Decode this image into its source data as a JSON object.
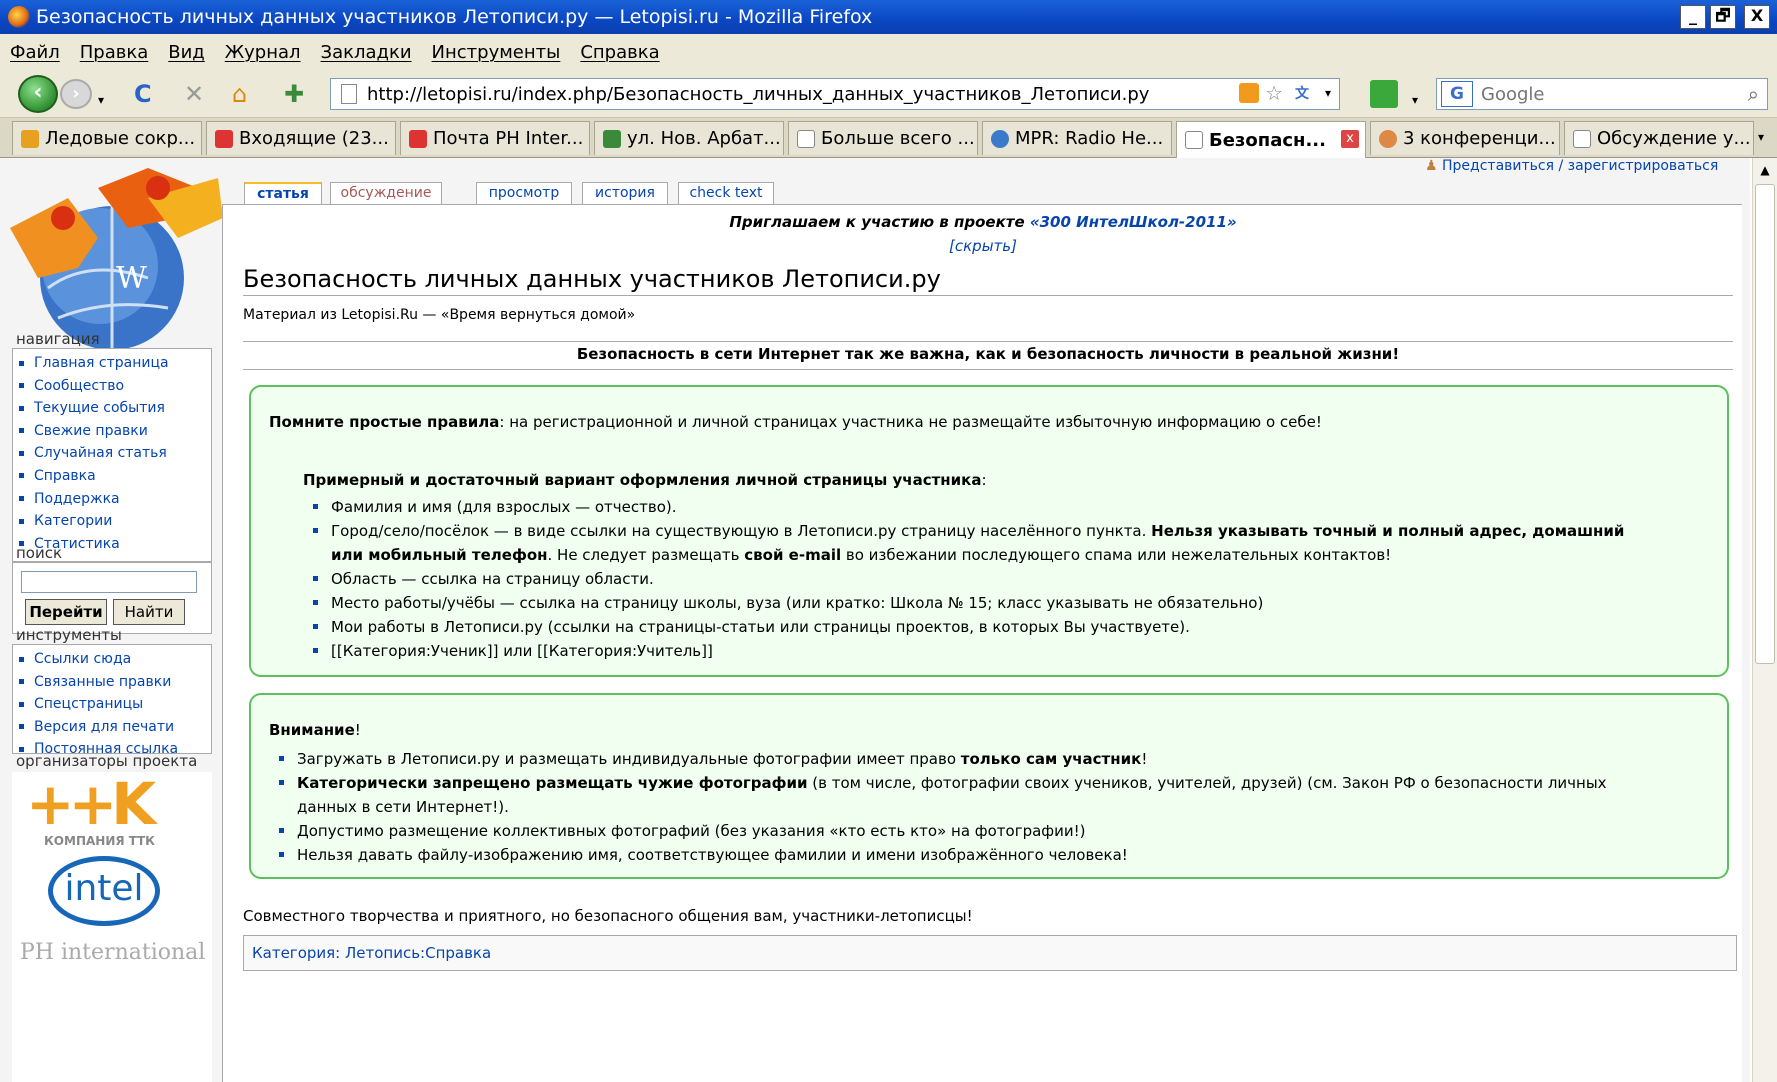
{
  "window": {
    "title": "Безопасность личных данных участников Летописи.ру — Letopisi.ru - Mozilla Firefox",
    "controls": [
      "_",
      "🗗",
      "X"
    ]
  },
  "menu": [
    "Файл",
    "Правка",
    "Вид",
    "Журнал",
    "Закладки",
    "Инструменты",
    "Справка"
  ],
  "navbar": {
    "url": "http://letopisi.ru/index.php/Безопасность_личных_данных_участников_Летописи.ру",
    "search_placeholder": "Google",
    "search_engine_label": "G"
  },
  "tabs": [
    {
      "label": "Ледовые сокр...",
      "color": "#e8a020"
    },
    {
      "label": "Входящие (23...",
      "color": "#d33"
    },
    {
      "label": "Почта PH Inter...",
      "color": "#d33"
    },
    {
      "label": "ул. Нов. Арбат...",
      "color": "#3a8a3a"
    },
    {
      "label": "Больше всего ...",
      "color": "#ffffff"
    },
    {
      "label": "MPR: Radio He...",
      "color": "#3a7ac8"
    },
    {
      "label": "Безопасн...",
      "color": "#ffffff",
      "active": true
    },
    {
      "label": "3 конференци...",
      "color": "#d84"
    },
    {
      "label": "Обсуждение у...",
      "color": "#ffffff"
    }
  ],
  "tab_close": "x",
  "userlinks": "Представиться / зарегистрироваться",
  "sidebar": {
    "nav_heading": "навигация",
    "nav_items": [
      "Главная страница",
      "Сообщество",
      "Текущие события",
      "Свежие правки",
      "Случайная статья",
      "Справка",
      "Поддержка",
      "Категории",
      "Статистика"
    ],
    "search_heading": "поиск",
    "go_button": "Перейти",
    "find_button": "Найти",
    "tools_heading": "инструменты",
    "tools_items": [
      "Ссылки сюда",
      "Связанные правки",
      "Спецстраницы",
      "Версия для печати",
      "Постоянная ссылка"
    ],
    "orgs_heading": "организаторы проекта",
    "org_logos": [
      {
        "name": "КОМПАНИЯ ТТК",
        "mark": "++K"
      },
      {
        "name": "intel"
      },
      {
        "name": "PH international"
      }
    ]
  },
  "content_tabs": [
    "статья",
    "обсуждение",
    "просмотр",
    "история",
    "check text"
  ],
  "notice": {
    "text": "Приглашаем к участию в проекте ",
    "link": "«300 ИнтелШкол-2011»",
    "hide": "[скрыть]"
  },
  "article": {
    "title": "Безопасность личных данных участников Летописи.ру",
    "sitesub": "Материал из Letopisi.Ru — «Время вернуться домой»",
    "lead": "Безопасность в сети Интернет так же важна, как и безопасность личности в реальной жизни!",
    "box1": {
      "rule_bold": "Помните простые правила",
      "rule_text": ": на регистрационной и личной страницах участника не размещайте избыточную информацию о себе!",
      "sub_bold": "Примерный и достаточный вариант оформления личной страницы участника",
      "sub_colon": ":",
      "items": [
        "Фамилия и имя (для взрослых — отчество).",
        "Область — ссылка на страницу области.",
        "Место работы/учёбы — ссылка на страницу школы, вуза (или кратко: Школа № 15; класс указывать не обязательно)",
        "Мои работы в Летописи.ру (ссылки на страницы-статьи или страницы проектов, в которых Вы участвуете).",
        "[[Категория:Ученик]] или [[Категория:Учитель]]"
      ],
      "city_item": {
        "a": "Город/село/посёлок — в виде ссылки на существующую в Летописи.ру страницу населённого пункта. ",
        "b_bold": "Нельзя указывать точный и полный адрес, домашний",
        "c_bold": "или мобильный телефон",
        "d": ". Не следует размещать ",
        "e_bold": "свой e-mail",
        "f": " во избежании последующего спама или нежелательных контактов!"
      }
    },
    "box2": {
      "heading_bold": "Внимание",
      "heading_mark": "!",
      "item1_a": "Загружать в Летописи.ру и размещать индивидуальные фотографии имеет право ",
      "item1_bold": "только сам участник",
      "item1_end": "!",
      "item2_bold": "Категорически запрещено размещать чужие фотографии",
      "item2_a": " (в том числе, фотографии своих учеников, учителей, друзей) (см. Закон РФ о безопасности личных",
      "item2_b": "данных в сети Интернет!).",
      "item3": "Допустимо размещение коллективных фотографий (без указания «кто есть кто» на фотографии!)",
      "item4": "Нельзя давать файлу-изображению имя, соответствующее фамилии и имени изображённого человека!"
    },
    "closing": "Совместного творчества и приятного, но безопасного общения вам, участники-летописцы!",
    "category": "Категория: Летопись:Справка"
  }
}
